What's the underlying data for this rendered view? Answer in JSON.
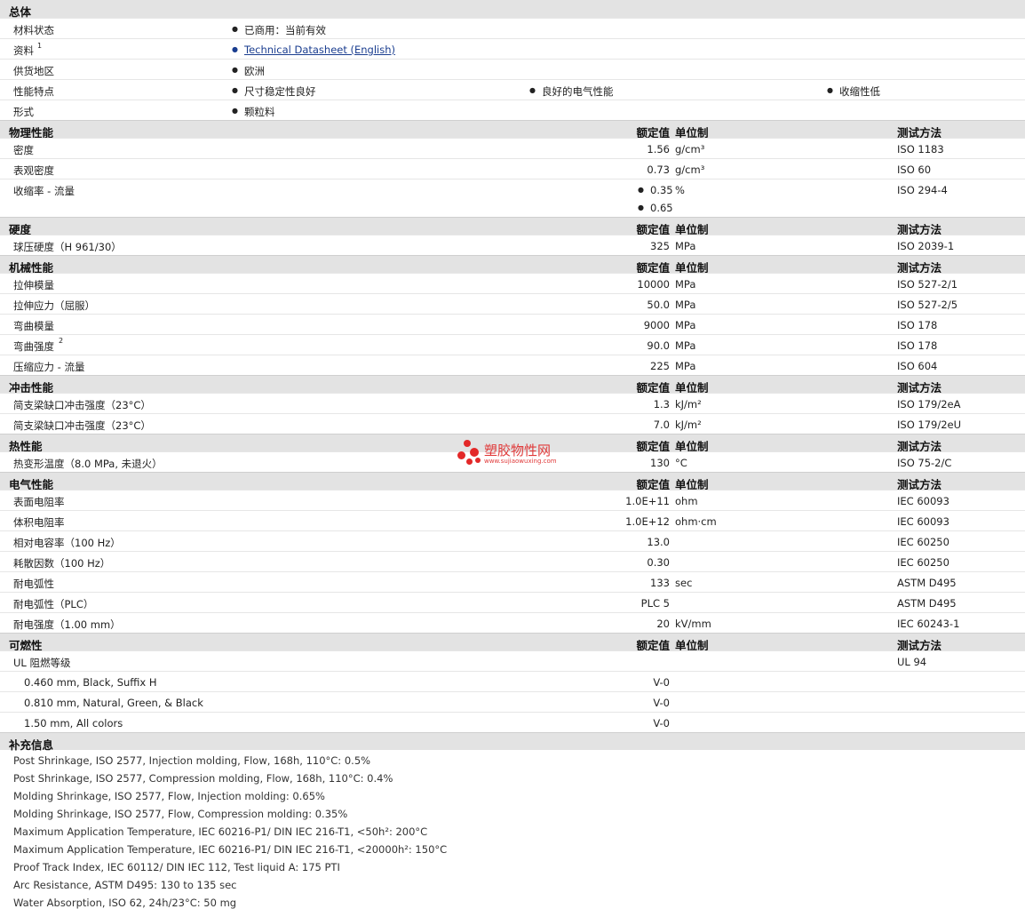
{
  "general": {
    "title": "总体",
    "rows": [
      {
        "label": "材料状态",
        "items": [
          "已商用：当前有效"
        ]
      },
      {
        "label": "资料",
        "sup": "1",
        "link": "Technical Datasheet (English)"
      },
      {
        "label": "供货地区",
        "items": [
          "欧洲"
        ]
      },
      {
        "label": "性能特点",
        "items": [
          "尺寸稳定性良好",
          "良好的电气性能",
          "收缩性低"
        ]
      },
      {
        "label": "形式",
        "items": [
          "颗粒料"
        ]
      }
    ]
  },
  "headers": {
    "value": "额定值",
    "unit": "单位制",
    "method": "测试方法"
  },
  "physical": {
    "title": "物理性能",
    "rows": [
      {
        "label": "密度",
        "value": "1.56",
        "unit": "g/cm³",
        "method": "ISO 1183"
      },
      {
        "label": "表观密度",
        "value": "0.73",
        "unit": "g/cm³",
        "method": "ISO 60"
      },
      {
        "label": "收缩率 - 流量",
        "value": "0.35",
        "value2": "0.65",
        "unit": "%",
        "method": "ISO 294-4"
      }
    ]
  },
  "hardness": {
    "title": "硬度",
    "rows": [
      {
        "label": "球压硬度（H 961/30）",
        "value": "325",
        "unit": "MPa",
        "method": "ISO 2039-1"
      }
    ]
  },
  "mechanical": {
    "title": "机械性能",
    "rows": [
      {
        "label": "拉伸模量",
        "value": "10000",
        "unit": "MPa",
        "method": "ISO 527-2/1"
      },
      {
        "label": "拉伸应力（屈服）",
        "value": "50.0",
        "unit": "MPa",
        "method": "ISO 527-2/5"
      },
      {
        "label": "弯曲模量",
        "value": "9000",
        "unit": "MPa",
        "method": "ISO 178"
      },
      {
        "label": "弯曲强度",
        "sup": "2",
        "value": "90.0",
        "unit": "MPa",
        "method": "ISO 178"
      },
      {
        "label": "压缩应力 - 流量",
        "value": "225",
        "unit": "MPa",
        "method": "ISO 604"
      }
    ]
  },
  "impact": {
    "title": "冲击性能",
    "rows": [
      {
        "label": "简支梁缺口冲击强度（23°C）",
        "value": "1.3",
        "unit": "kJ/m²",
        "method": "ISO 179/2eA"
      },
      {
        "label": "简支梁缺口冲击强度（23°C）",
        "value": "7.0",
        "unit": "kJ/m²",
        "method": "ISO 179/2eU"
      }
    ]
  },
  "thermal": {
    "title": "热性能",
    "rows": [
      {
        "label": "热变形温度（8.0 MPa, 未退火）",
        "value": "130",
        "unit": "°C",
        "method": "ISO 75-2/C"
      }
    ]
  },
  "electrical": {
    "title": "电气性能",
    "rows": [
      {
        "label": "表面电阻率",
        "value": "1.0E+11",
        "unit": "ohm",
        "method": "IEC 60093"
      },
      {
        "label": "体积电阻率",
        "value": "1.0E+12",
        "unit": "ohm·cm",
        "method": "IEC 60093"
      },
      {
        "label": "相对电容率（100 Hz）",
        "value": "13.0",
        "unit": "",
        "method": "IEC 60250"
      },
      {
        "label": "耗散因数（100 Hz）",
        "value": "0.30",
        "unit": "",
        "method": "IEC 60250"
      },
      {
        "label": "耐电弧性",
        "value": "133",
        "unit": "sec",
        "method": "ASTM D495"
      },
      {
        "label": "耐电弧性（PLC）",
        "value": "PLC 5",
        "unit": "",
        "method": "ASTM D495"
      },
      {
        "label": "耐电强度（1.00 mm）",
        "value": "20",
        "unit": "kV/mm",
        "method": "IEC 60243-1"
      }
    ]
  },
  "flammability": {
    "title": "可燃性",
    "rows": [
      {
        "label": "UL 阻燃等级",
        "value": "",
        "unit": "",
        "method": "UL 94"
      },
      {
        "label": "0.460 mm, Black, Suffix H",
        "value": "V-0",
        "unit": "",
        "method": "",
        "indent": true
      },
      {
        "label": "0.810 mm, Natural, Green, & Black",
        "value": "V-0",
        "unit": "",
        "method": "",
        "indent": true
      },
      {
        "label": "1.50 mm, All colors",
        "value": "V-0",
        "unit": "",
        "method": "",
        "indent": true
      }
    ]
  },
  "supplement": {
    "title": "补充信息",
    "notes": [
      "Post Shrinkage, ISO 2577, Injection molding, Flow, 168h, 110°C: 0.5%",
      "Post Shrinkage, ISO 2577, Compression molding, Flow, 168h, 110°C: 0.4%",
      "Molding Shrinkage, ISO 2577, Flow, Injection molding: 0.65%",
      "Molding Shrinkage, ISO 2577, Flow, Compression molding: 0.35%",
      "Maximum Application Temperature, IEC 60216-P1/ DIN IEC 216-T1, <50h²: 200°C",
      "Maximum Application Temperature, IEC 60216-P1/ DIN IEC 216-T1, <20000h²: 150°C",
      "Proof Track Index, IEC 60112/ DIN IEC 112, Test liquid A: 175 PTI",
      "Arc Resistance, ASTM D495: 130 to 135 sec",
      "Water Absorption, ISO 62, 24h/23°C: 50 mg"
    ]
  },
  "watermark": {
    "name": "塑胶物性网",
    "url": "www.sujiaowuxing.com",
    "color": "#e03a3a"
  }
}
